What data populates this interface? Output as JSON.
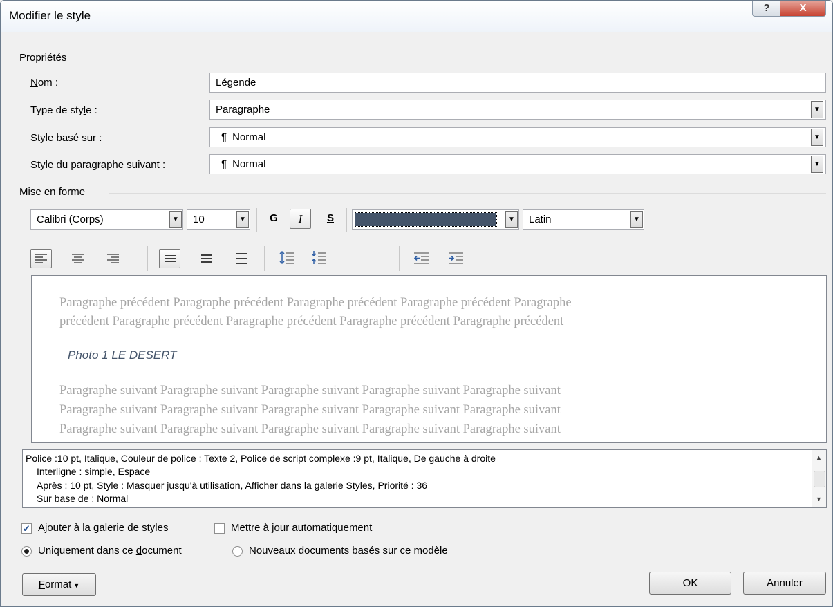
{
  "window": {
    "title": "Modifier le style",
    "help_glyph": "?",
    "close_glyph": "X"
  },
  "properties": {
    "section_label": "Propriétés",
    "name_label_u": "N",
    "name_label_rest": "om :",
    "name_value": "Légende",
    "type_label_a": "Type de sty",
    "type_label_u": "l",
    "type_label_b": "e :",
    "type_value": "Paragraphe",
    "based_label_a": "Style ",
    "based_label_u": "b",
    "based_label_b": "asé sur :",
    "based_value": "Normal",
    "next_label_u": "S",
    "next_label_rest": "tyle du paragraphe suivant :",
    "next_value": "Normal",
    "pilcrow": "¶"
  },
  "formatting": {
    "section_label": "Mise en forme",
    "font": "Calibri (Corps)",
    "size": "10",
    "bold": "G",
    "italic": "I",
    "underline": "S",
    "color": "#44546a",
    "script": "Latin"
  },
  "preview": {
    "prev_line1": "Paragraphe précédent Paragraphe précédent Paragraphe précédent Paragraphe précédent Paragraphe",
    "prev_line2": "précédent Paragraphe précédent Paragraphe précédent Paragraphe précédent Paragraphe précédent",
    "sample": "Photo 1 LE DESERT",
    "next_line1": "Paragraphe suivant Paragraphe suivant Paragraphe suivant Paragraphe suivant Paragraphe suivant",
    "next_line2": "Paragraphe suivant Paragraphe suivant Paragraphe suivant Paragraphe suivant Paragraphe suivant",
    "next_line3": "Paragraphe suivant Paragraphe suivant Paragraphe suivant Paragraphe suivant Paragraphe suivant"
  },
  "description": {
    "line1": "Police :10 pt, Italique, Couleur de police : Texte 2, Police de script complexe :9 pt, Italique, De gauche à droite",
    "line2": "Interligne : simple, Espace",
    "line3": "Après : 10 pt, Style : Masquer jusqu'à utilisation, Afficher dans la galerie Styles, Priorité : 36",
    "line4": "Sur base de : Normal"
  },
  "options": {
    "add_gallery_a": "Ajouter à la galerie de ",
    "add_gallery_u": "s",
    "add_gallery_b": "tyles",
    "add_gallery_checked": true,
    "auto_update_a": "Mettre à jo",
    "auto_update_u": "u",
    "auto_update_b": "r automatiquement",
    "auto_update_checked": false,
    "only_doc_a": "Uniquement dans ce ",
    "only_doc_u": "d",
    "only_doc_b": "ocument",
    "new_docs": "Nouveaux documents basés sur ce modèle",
    "selected_scope": "only_doc"
  },
  "buttons": {
    "format_u": "F",
    "format_rest": "ormat",
    "ok": "OK",
    "cancel": "Annuler"
  }
}
